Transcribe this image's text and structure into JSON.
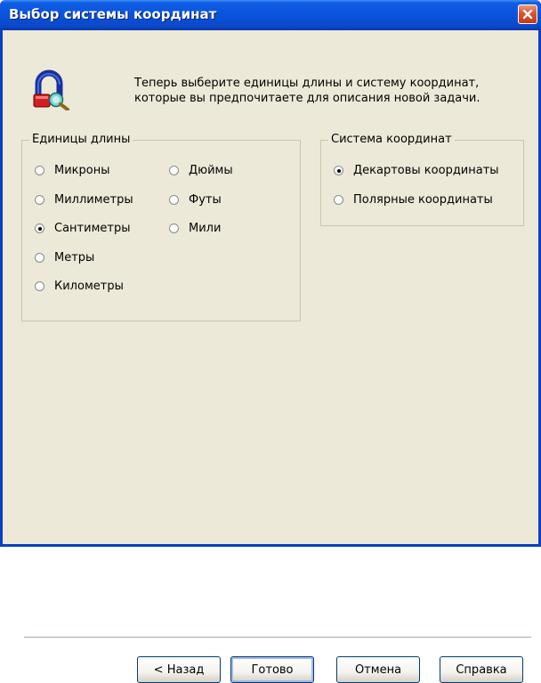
{
  "window": {
    "title": "Выбор системы координат"
  },
  "intro": {
    "line1": "Теперь выберите единицы длины и систему координат,",
    "line2": "которые вы предпочитаете для описания новой задачи."
  },
  "units": {
    "title": "Единицы длины",
    "options": [
      "Микроны",
      "Миллиметры",
      "Сантиметры",
      "Метры",
      "Километры",
      "Дюймы",
      "Футы",
      "Мили"
    ],
    "selected": "Сантиметры"
  },
  "coords": {
    "title": "Система координат",
    "options": [
      "Декартовы координаты",
      "Полярные координаты"
    ],
    "selected": "Декартовы координаты"
  },
  "buttons": {
    "back": "< Назад",
    "finish": "Готово",
    "cancel": "Отмена",
    "help": "Справка"
  },
  "colors": {
    "titlebar": "#0a53dc",
    "window_bg": "#ece9d8",
    "close": "#d9542b"
  }
}
